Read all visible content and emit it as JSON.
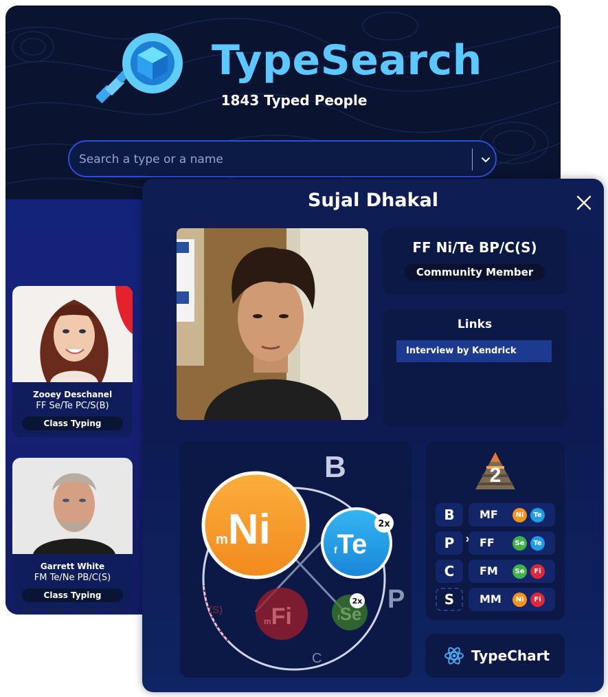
{
  "app": {
    "title": "TypeSearch",
    "subtitle": "1843 Typed People"
  },
  "search": {
    "placeholder": "Search a type or a name",
    "value": ""
  },
  "cards": [
    {
      "name": "Zooey Deschanel",
      "type": "FF Se/Te PC/S(B)",
      "badge": "Class Typing"
    },
    {
      "name": "Garrett White",
      "type": "FM Te/Ne PB/C(S)",
      "badge": "Class Typing"
    }
  ],
  "modal": {
    "title": "Sujal Dhakal",
    "type_code": "FF Ni/Te BP/C(S)",
    "member_badge": "Community Member",
    "links_title": "Links",
    "links": [
      "Interview by Kendrick"
    ]
  },
  "chart": {
    "b_label": "B",
    "p_label": "P",
    "c_label": "C",
    "s_label": "(S)",
    "functions": [
      {
        "prefix": "m",
        "name": "Ni",
        "color": "#f5921e"
      },
      {
        "prefix": "f",
        "name": "Te",
        "color": "#1e9ce6",
        "badge": "2x"
      },
      {
        "prefix": "m",
        "name": "Fi",
        "color": "#b21f2c"
      },
      {
        "prefix": "f",
        "name": "Se",
        "color": "#3e8e2a",
        "badge": "2x"
      }
    ]
  },
  "quadra": {
    "level": "2",
    "rows": [
      {
        "letter": "B",
        "sup": "",
        "pill": "MF",
        "dots": [
          {
            "fn": "Ni",
            "color": "#f5921e"
          },
          {
            "fn": "Te",
            "color": "#1e9ce6"
          }
        ]
      },
      {
        "letter": "P",
        "sup": "x2",
        "pill": "FF",
        "dots": [
          {
            "fn": "Se",
            "color": "#3fb24a"
          },
          {
            "fn": "Te",
            "color": "#1e9ce6"
          }
        ]
      },
      {
        "letter": "C",
        "sup": "",
        "pill": "FM",
        "dots": [
          {
            "fn": "Se",
            "color": "#3fb24a"
          },
          {
            "fn": "Fi",
            "color": "#e0263a"
          }
        ]
      },
      {
        "letter": "S",
        "sup": "",
        "pill": "MM",
        "dots": [
          {
            "fn": "Ni",
            "color": "#f5921e"
          },
          {
            "fn": "Fi",
            "color": "#e0263a"
          }
        ]
      }
    ]
  },
  "typechart": {
    "label": "TypeChart"
  }
}
